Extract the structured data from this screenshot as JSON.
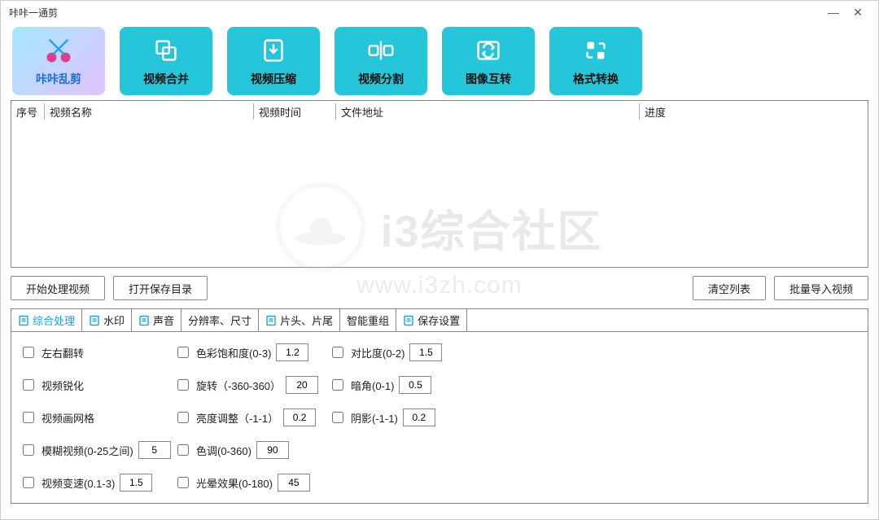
{
  "window": {
    "title": "咔咔一通剪"
  },
  "toolbar": [
    {
      "id": "random-cut",
      "label": "咔咔乱剪"
    },
    {
      "id": "merge",
      "label": "视频合并"
    },
    {
      "id": "compress",
      "label": "视频压缩"
    },
    {
      "id": "split",
      "label": "视频分割"
    },
    {
      "id": "img-convert",
      "label": "图像互转"
    },
    {
      "id": "fmt-convert",
      "label": "格式转换"
    }
  ],
  "columns": {
    "index": "序号",
    "name": "视频名称",
    "time": "视频时间",
    "path": "文件地址",
    "progress": "进度"
  },
  "actions": {
    "start": "开始处理视频",
    "open_dir": "打开保存目录",
    "clear": "清空列表",
    "import": "批量导入视频"
  },
  "tabs": [
    "综合处理",
    "水印",
    "声音",
    "分辨率、尺寸",
    "片头、片尾",
    "智能重组",
    "保存设置"
  ],
  "settings": {
    "flip_h": {
      "label": "左右翻转"
    },
    "sharpen": {
      "label": "视频锐化"
    },
    "grid": {
      "label": "视频画网格"
    },
    "blur": {
      "label": "模糊视频(0-25之间)",
      "value": "5"
    },
    "speed": {
      "label": "视频变速(0.1-3)",
      "value": "1.5"
    },
    "saturation": {
      "label": "色彩饱和度(0-3)",
      "value": "1.2"
    },
    "rotate": {
      "label": "旋转（-360-360）",
      "value": "20"
    },
    "brightness": {
      "label": "亮度调整（-1-1）",
      "value": "0.2"
    },
    "hue": {
      "label": "色调(0-360)",
      "value": "90"
    },
    "halo": {
      "label": "光晕效果(0-180)",
      "value": "45"
    },
    "contrast": {
      "label": "对比度(0-2)",
      "value": "1.5"
    },
    "vignette": {
      "label": "暗角(0-1)",
      "value": "0.5"
    },
    "shadow": {
      "label": "阴影(-1-1)",
      "value": "0.2"
    }
  },
  "watermark": {
    "big": "i3综合社区",
    "url": "www.i3zh.com"
  }
}
